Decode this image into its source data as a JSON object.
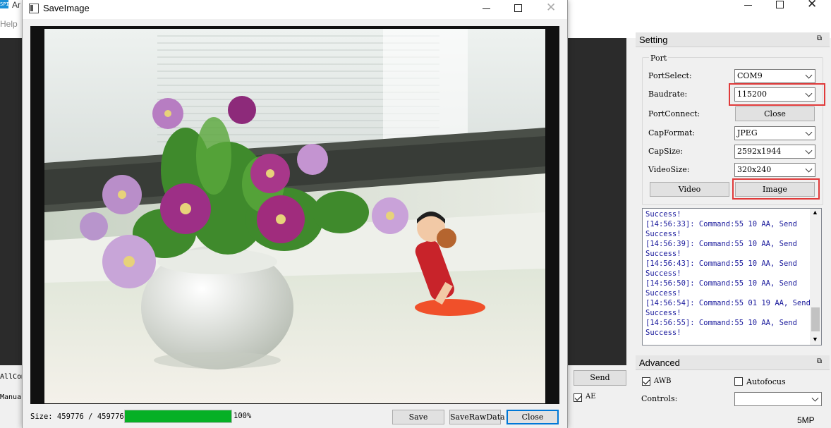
{
  "main_window": {
    "app_title_fragment": "Ar",
    "menu_help": "Help",
    "left_labels": {
      "allcom": "AllCom",
      "manual": "Manual"
    },
    "send_label": "Send",
    "ae_label": "AE",
    "ae_checked": true,
    "status_right": "5MP"
  },
  "setting_panel": {
    "title": "Setting",
    "port_group": "Port",
    "rows": [
      {
        "label": "PortSelect:",
        "value": "COM9"
      },
      {
        "label": "Baudrate:",
        "value": "115200"
      },
      {
        "label": "PortConnect:",
        "button": "Close"
      },
      {
        "label": "CapFormat:",
        "value": "JPEG"
      },
      {
        "label": "CapSize:",
        "value": "2592x1944"
      },
      {
        "label": "VideoSize:",
        "value": "320x240"
      }
    ],
    "video_button": "Video",
    "image_button": "Image",
    "log": [
      "Success!",
      "[14:56:33]: Command:55 10 AA, Send",
      "Success!",
      "[14:56:39]: Command:55 10 AA, Send",
      "Success!",
      "[14:56:43]: Command:55 10 AA, Send",
      "Success!",
      "[14:56:50]: Command:55 10 AA, Send",
      "Success!",
      "[14:56:54]: Command:55 01 19 AA, Send",
      "Success!",
      "[14:56:55]: Command:55 10 AA, Send",
      "Success!"
    ]
  },
  "advanced_panel": {
    "title": "Advanced",
    "awb_label": "AWB",
    "awb_checked": true,
    "autofocus_label": "Autofocus",
    "autofocus_checked": false,
    "controls_label": "Controls:",
    "controls_value": ""
  },
  "dialog": {
    "title": "SaveImage",
    "size_text": "Size: 459776 / 459776",
    "progress_fraction": 1.0,
    "progress_text": "100%",
    "buttons": {
      "save": "Save",
      "save_raw": "SaveRawData",
      "close": "Close"
    },
    "accent_color": "#0078d7",
    "progress_color": "#06b025"
  }
}
